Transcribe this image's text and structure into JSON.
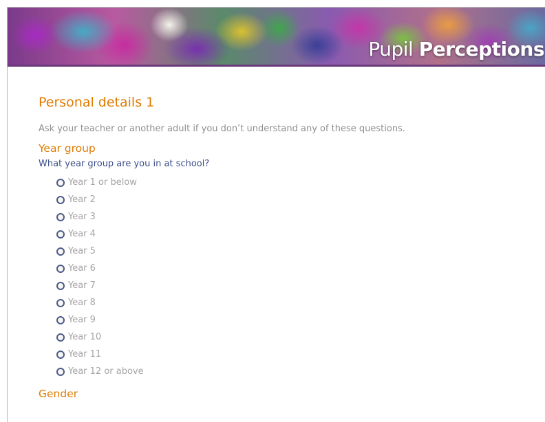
{
  "banner": {
    "title_light": "Pupil ",
    "title_bold": "Perceptions"
  },
  "page": {
    "heading": "Personal details 1",
    "instructions": "Ask your teacher or another adult if you don’t understand any of these questions."
  },
  "year_group": {
    "title": "Year group",
    "question": "What year group are you in at school?",
    "options": [
      {
        "label": "Year 1 or below",
        "selected": false
      },
      {
        "label": "Year 2",
        "selected": false
      },
      {
        "label": "Year 3",
        "selected": false
      },
      {
        "label": "Year 4",
        "selected": false
      },
      {
        "label": "Year 5",
        "selected": false
      },
      {
        "label": "Year 6",
        "selected": false
      },
      {
        "label": "Year 7",
        "selected": false
      },
      {
        "label": "Year 8",
        "selected": false
      },
      {
        "label": "Year 9",
        "selected": false
      },
      {
        "label": "Year 10",
        "selected": false
      },
      {
        "label": "Year 11",
        "selected": false
      },
      {
        "label": "Year 12 or above",
        "selected": false
      }
    ]
  },
  "gender": {
    "title": "Gender"
  },
  "colors": {
    "heading": "#e07b00",
    "question": "#3d4f8a",
    "option_text": "#a4a4a4",
    "instructions": "#8f8f8f",
    "radio_border": "#4a5a86"
  },
  "icons": {
    "radio": "radio-button-icon"
  }
}
